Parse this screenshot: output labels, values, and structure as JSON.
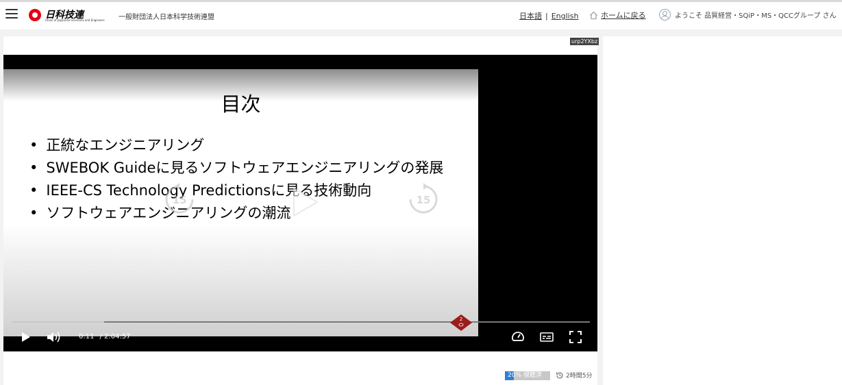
{
  "header": {
    "logo_text": "日科技連",
    "logo_subtext": "Union of Japanese Scientists and Engineers",
    "org_name": "一般財団法人日本科学技術連盟",
    "lang_ja": "日本語",
    "lang_sep": "|",
    "lang_en": "English",
    "home_label": "ホームに戻る",
    "user_greeting": "ようこそ 品質経営・SQiP・MS・QCCグループ さん"
  },
  "video": {
    "badge": "urp2YXbz",
    "slide": {
      "title": "目次",
      "bullets": [
        "正統なエンジニアリング",
        "SWEBOK Guideに見るソフトウェアエンジニアリングの発展",
        "IEEE-CS Technology Predictionsに見る技術動向",
        "ソフトウェアエンジニアリングの潮流"
      ]
    },
    "skip_back_label": "15",
    "skip_forward_label": "15",
    "current_time": "0:11",
    "total_time": "/ 2:04:57",
    "buffered_fraction": 0.16,
    "chapter_number": "2"
  },
  "status": {
    "watched_label": "20% 視聴済",
    "watched_fraction": 0.2,
    "duration_label": "2時間5分"
  },
  "colors": {
    "accent": "#2f7fd6",
    "brand": "#e60012",
    "chapter_marker": "#9b1c1c"
  }
}
